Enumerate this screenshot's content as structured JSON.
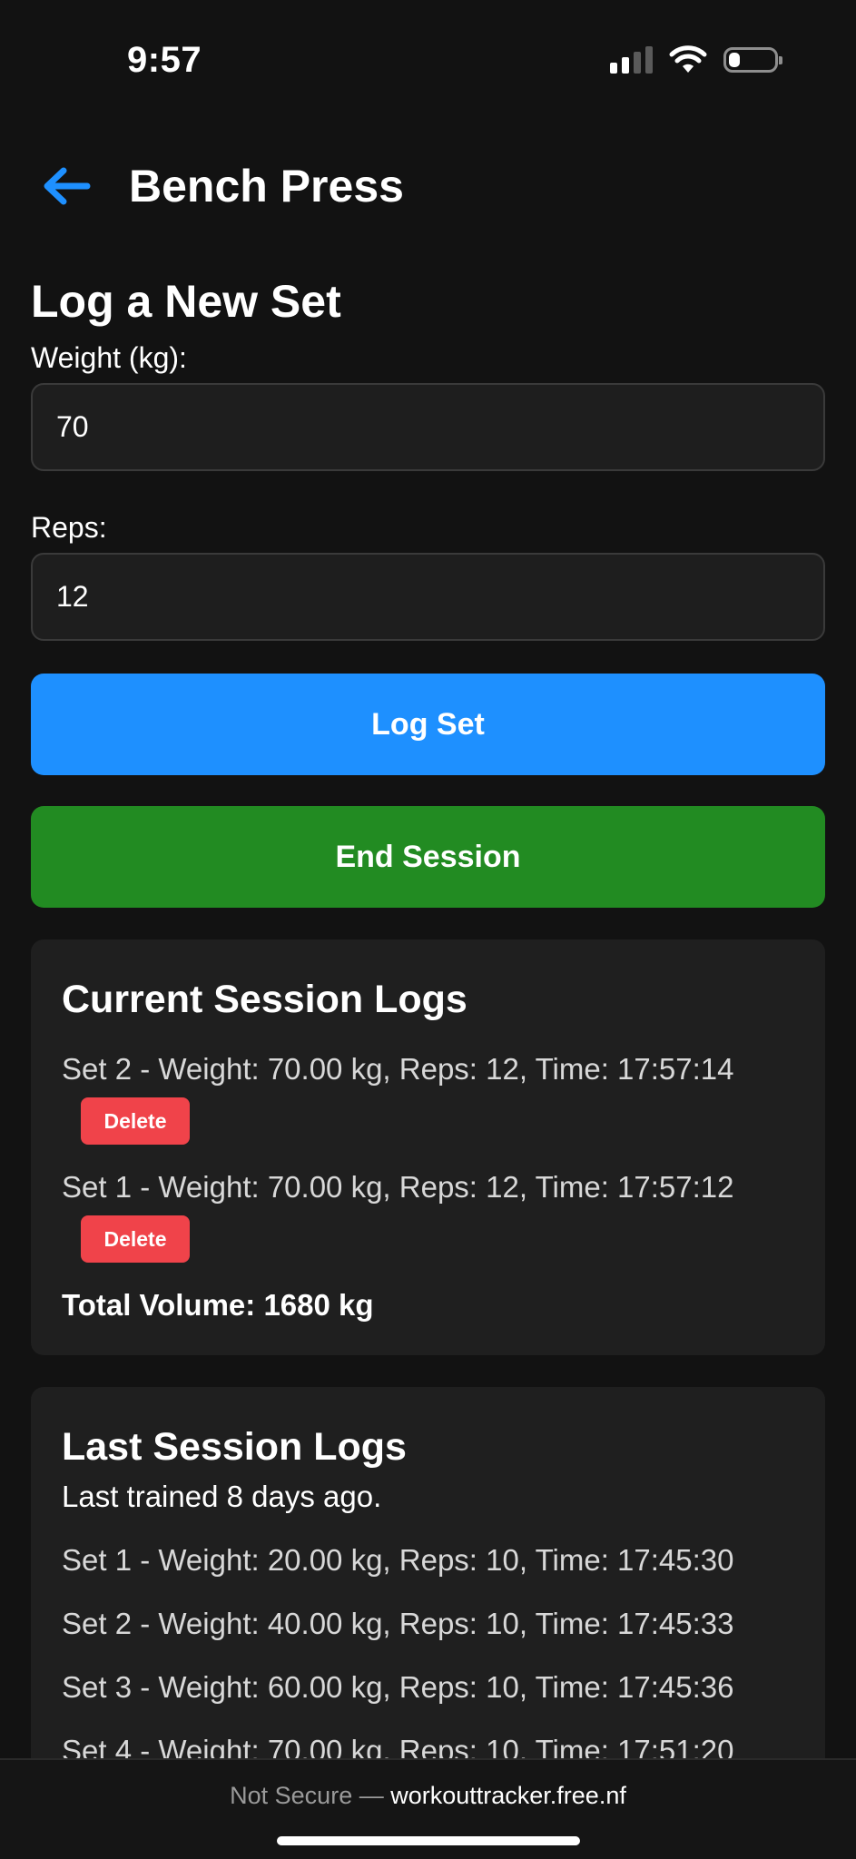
{
  "status_bar": {
    "time": "9:57",
    "signal_bars_active": 2,
    "signal_bars_total": 4,
    "battery_level": 0.25
  },
  "header": {
    "back_icon": "arrow-left-icon",
    "title": "Bench Press",
    "accent_color": "#1e90ff"
  },
  "form": {
    "section_title": "Log a New Set",
    "weight_label": "Weight (kg):",
    "weight_value": "70",
    "reps_label": "Reps:",
    "reps_value": "12",
    "log_button": "Log Set",
    "end_button": "End Session"
  },
  "current_session": {
    "title": "Current Session Logs",
    "logs": [
      {
        "text": "Set 2 - Weight: 70.00 kg, Reps: 12, Time: 17:57:14",
        "delete_label": "Delete"
      },
      {
        "text": "Set 1 - Weight: 70.00 kg, Reps: 12, Time: 17:57:12",
        "delete_label": "Delete"
      }
    ],
    "total_volume": "Total Volume: 1680 kg"
  },
  "last_session": {
    "title": "Last Session Logs",
    "last_trained": "Last trained 8 days ago.",
    "logs": [
      "Set 1 - Weight: 20.00 kg, Reps: 10, Time: 17:45:30",
      "Set 2 - Weight: 40.00 kg, Reps: 10, Time: 17:45:33",
      "Set 3 - Weight: 60.00 kg, Reps: 10, Time: 17:45:36",
      "Set 4 - Weight: 70.00 kg, Reps: 10, Time: 17:51:20"
    ]
  },
  "browser": {
    "security_label": "Not Secure —",
    "domain": "workouttracker.free.nf"
  },
  "colors": {
    "background": "#121212",
    "card": "#1f1f1f",
    "log_button": "#1e90ff",
    "end_button": "#228b22",
    "delete_button": "#f0434a"
  }
}
